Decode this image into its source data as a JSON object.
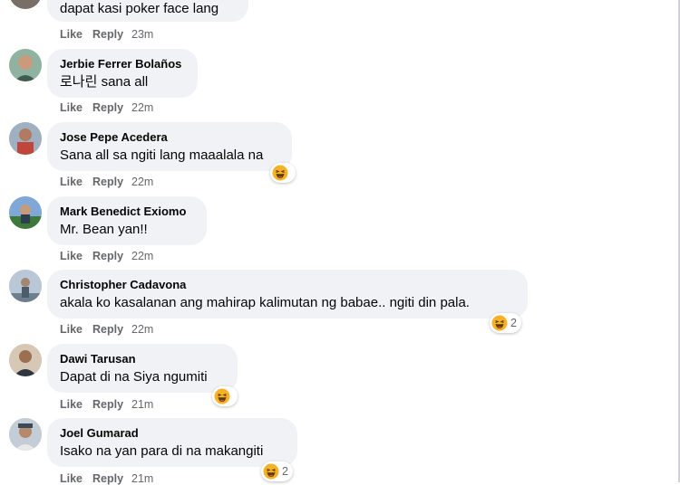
{
  "comments": [
    {
      "name": "",
      "text": "dapat kasi poker face lang",
      "like": "Like",
      "reply": "Reply",
      "time": "23m",
      "reactions": null
    },
    {
      "name": "Jerbie Ferrer Bolaños",
      "text": "로나린 sana all",
      "like": "Like",
      "reply": "Reply",
      "time": "22m",
      "reactions": null
    },
    {
      "name": "Jose Pepe Acedera",
      "text": "Sana all sa ngiti lang maaalala na",
      "like": "Like",
      "reply": "Reply",
      "time": "22m",
      "reactions": {
        "icon": "haha-emoji-icon",
        "count": ""
      }
    },
    {
      "name": "Mark Benedict Exiomo",
      "text": "Mr. Bean yan!!",
      "like": "Like",
      "reply": "Reply",
      "time": "22m",
      "reactions": null
    },
    {
      "name": "Christopher Cadavona",
      "text": "akala ko kasalanan ang mahirap kalimutan ng babae.. ngiti din pala.",
      "like": "Like",
      "reply": "Reply",
      "time": "22m",
      "reactions": {
        "icon": "haha-emoji-icon",
        "count": "2"
      }
    },
    {
      "name": "Dawi Tarusan",
      "text": "Dapat di na Siya ngumiti",
      "like": "Like",
      "reply": "Reply",
      "time": "21m",
      "reactions": {
        "icon": "haha-emoji-icon",
        "count": ""
      }
    },
    {
      "name": "Joel Gumarad",
      "text": "Isako na yan para di na makangiti",
      "like": "Like",
      "reply": "Reply",
      "time": "21m",
      "reactions": {
        "icon": "haha-emoji-icon",
        "count": "2"
      }
    }
  ],
  "colors": {
    "bubble": "#f0f2f5",
    "meta": "#65676b",
    "text": "#050505"
  }
}
